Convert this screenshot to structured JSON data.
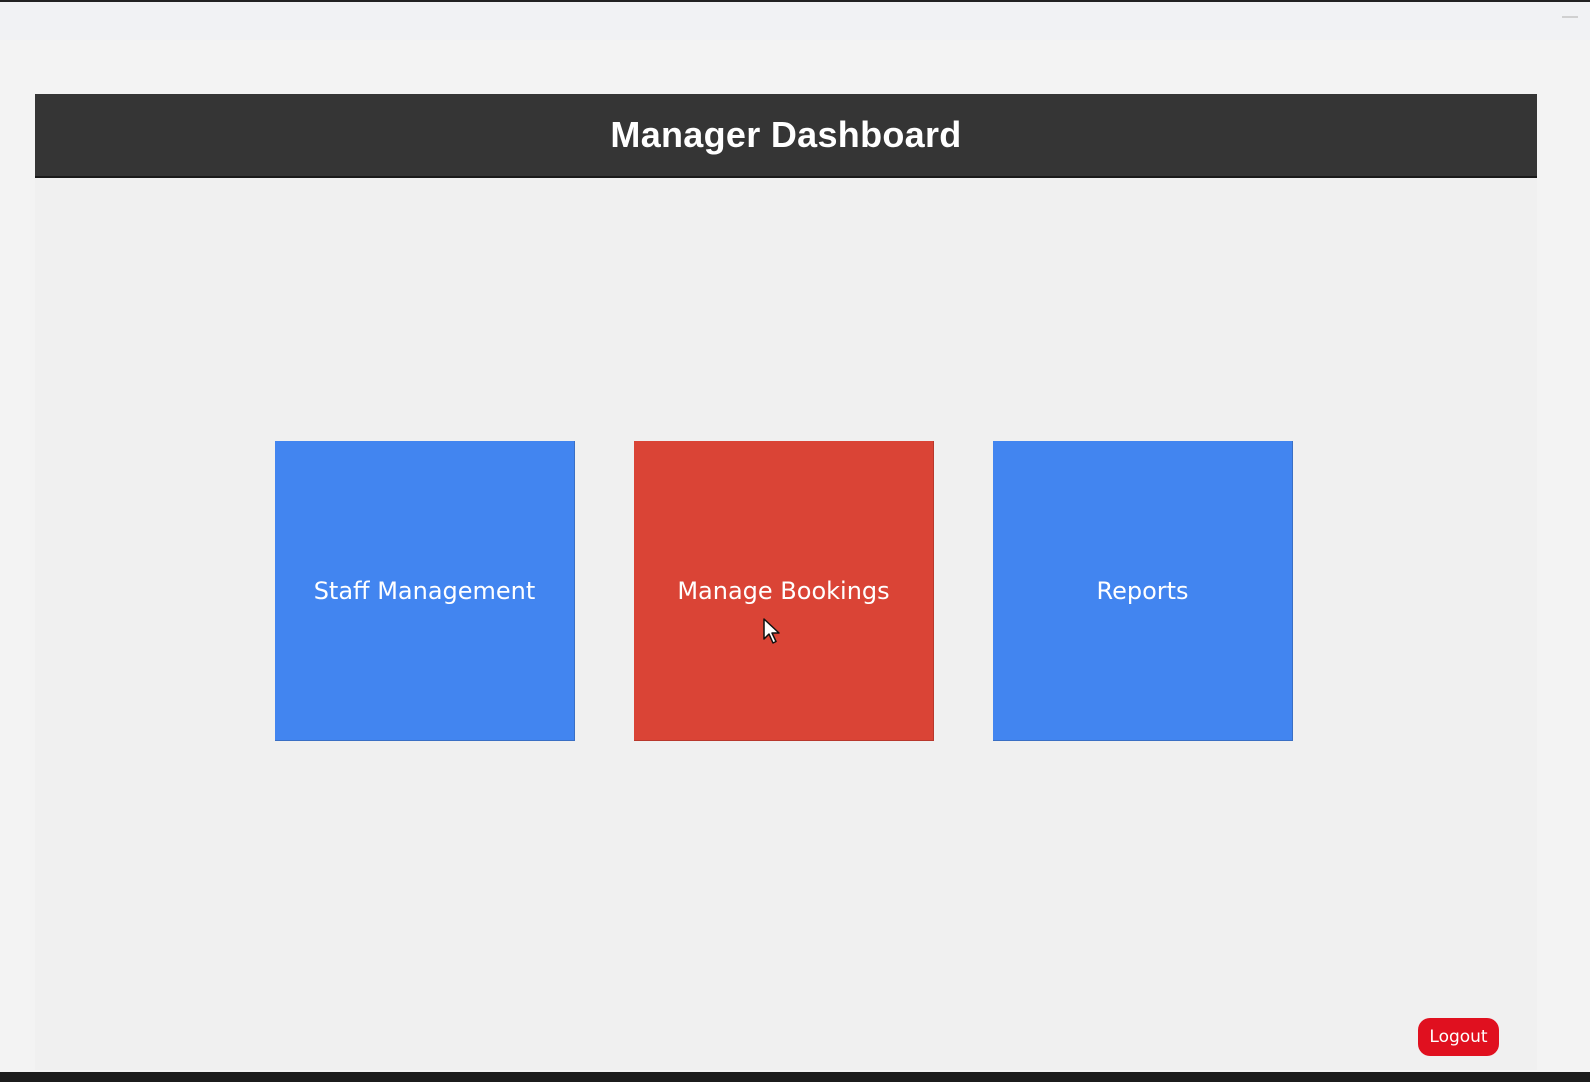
{
  "header": {
    "title": "Manager Dashboard"
  },
  "tiles": [
    {
      "label": "Staff Management",
      "color": "#4285f0"
    },
    {
      "label": "Manage Bookings",
      "color": "#da4436"
    },
    {
      "label": "Reports",
      "color": "#4285f0"
    }
  ],
  "logout": {
    "label": "Logout",
    "color": "#e0101f"
  },
  "icons": {
    "cursor": "mouse-pointer-icon",
    "window_minimize": "minimize-icon"
  }
}
